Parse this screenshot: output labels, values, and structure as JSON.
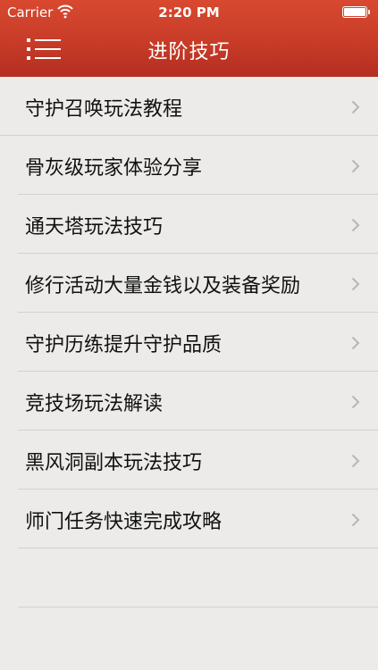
{
  "status_bar": {
    "carrier": "Carrier",
    "time": "2:20 PM"
  },
  "nav": {
    "title": "进阶技巧",
    "menu_icon": "menu-list-icon"
  },
  "items": [
    {
      "label": "守护召唤玩法教程"
    },
    {
      "label": "骨灰级玩家体验分享"
    },
    {
      "label": "通天塔玩法技巧"
    },
    {
      "label": "修行活动大量金钱以及装备奖励"
    },
    {
      "label": "守护历练提升守护品质"
    },
    {
      "label": "竞技场玩法解读"
    },
    {
      "label": "黑风洞副本玩法技巧"
    },
    {
      "label": "师门任务快速完成攻略"
    }
  ],
  "colors": {
    "header": "#c63a27",
    "background": "#ecebe9",
    "chevron": "#b8b6b2"
  }
}
